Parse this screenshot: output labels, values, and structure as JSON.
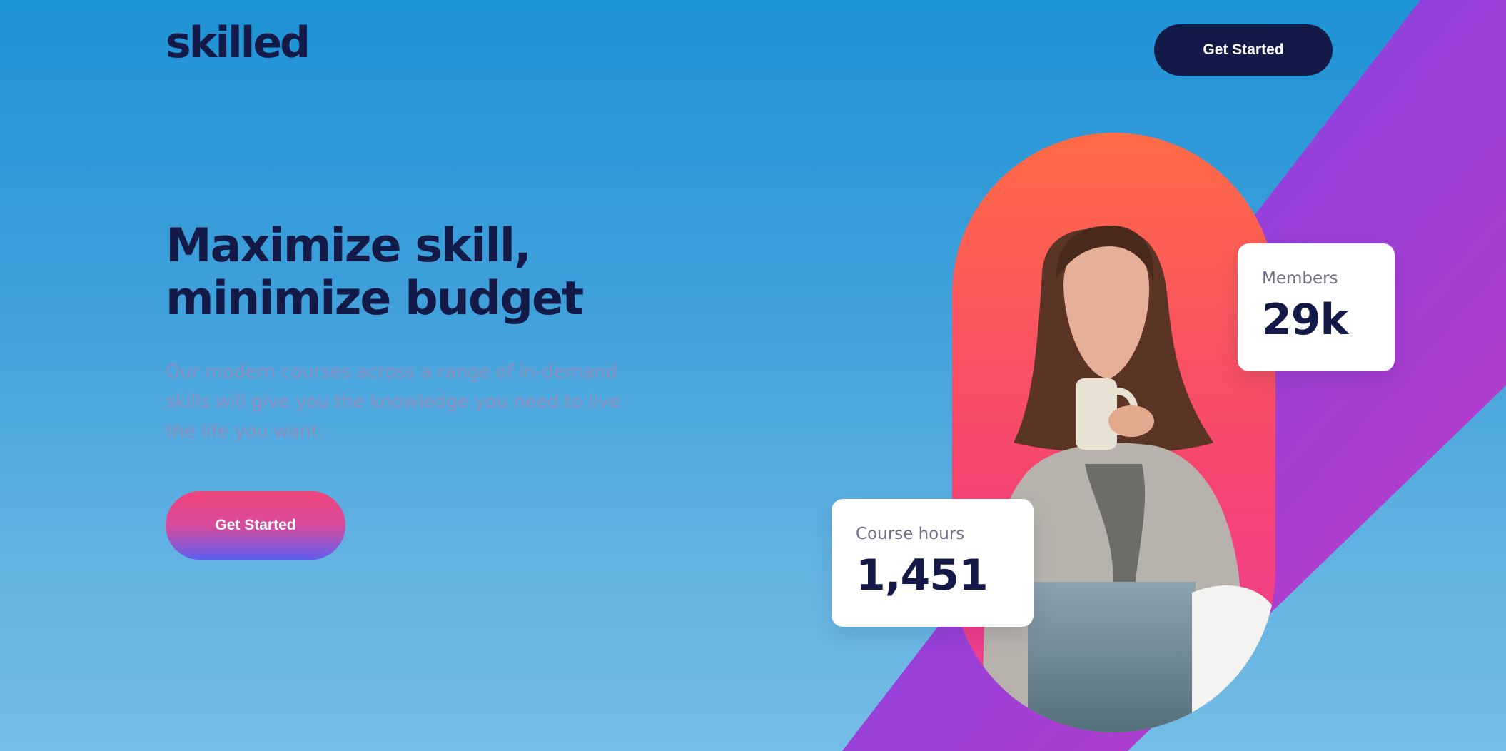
{
  "header": {
    "logo_text": "skilled",
    "cta_label": "Get Started"
  },
  "hero": {
    "headline_line1": "Maximize skill,",
    "headline_line2": "minimize budget",
    "description": "Our modern courses across a range of in-demand skills will give you the knowledge you need to live the life you want.",
    "cta_label": "Get Started"
  },
  "stats": {
    "members": {
      "label": "Members",
      "value": "29k"
    },
    "course_hours": {
      "label": "Course hours",
      "value": "1,451"
    }
  },
  "colors": {
    "navy": "#141a47",
    "accent_pink": "#f0457b",
    "accent_purple": "#6d3ff0",
    "background_blue": "#1e93d6"
  }
}
